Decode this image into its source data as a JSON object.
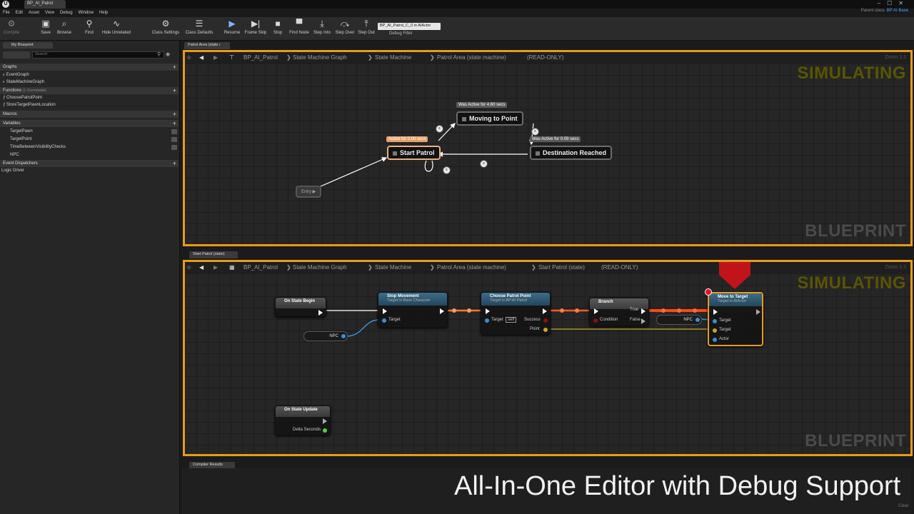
{
  "window": {
    "tab": "BP_AI_Patrol",
    "parent_class_label": "Parent class",
    "parent_class_value": "BP AI Base"
  },
  "menu": [
    "File",
    "Edit",
    "Asset",
    "View",
    "Debug",
    "Window",
    "Help"
  ],
  "toolbar": {
    "compile": "Compile",
    "save": "Save",
    "browse": "Browse",
    "find": "Find",
    "hide_unrelated": "Hide Unrelated",
    "class_settings": "Class Settings",
    "class_defaults": "Class Defaults",
    "resume": "Resume",
    "frame_skip": "Frame Skip",
    "stop": "Stop",
    "find_node": "Find Node",
    "step_into": "Step Into",
    "step_over": "Step Over",
    "step_out": "Step Out",
    "debug_object": "BP_AI_Patrol_C_0 in AIActor",
    "debug_filter": "Debug Filter"
  },
  "left_panel": {
    "tab": "My Blueprint",
    "search_placeholder": "Search",
    "graphs_header": "Graphs",
    "graphs": [
      "EventGraph",
      "StateMachineGraph"
    ],
    "functions_header": "Functions",
    "functions_note": "(1 Overridable)",
    "functions": [
      "ChoosePatrolPoint",
      "StoreTargetPawnLocation"
    ],
    "macros_header": "Macros",
    "variables_header": "Variables",
    "variables": [
      "TargetPawn",
      "TargetPoint",
      "TimeBetweenVisibilityChecks",
      "NPC"
    ],
    "dispatchers_header": "Event Dispatchers",
    "logic_driver": "Logic Driver"
  },
  "top_graph": {
    "tab": "Patrol Area (state ı",
    "crumbs": [
      "BP_AI_Patrol",
      "State Machine Graph",
      "State Machine",
      "Patrol Area (state machine)",
      "(READ-ONLY)"
    ],
    "zoom": "Zoom 1:1",
    "watermark_top": "SIMULATING",
    "watermark_bottom": "BLUEPRINT",
    "states": {
      "moving": {
        "label": "Moving to Point",
        "badge": "Was Active for 4.60 secs"
      },
      "start": {
        "label": "Start Patrol",
        "badge": "Active for 0.00 secs"
      },
      "dest": {
        "label": "Destination Reached",
        "badge": "Was Active for 0.09 secs"
      },
      "entry": "Entry"
    }
  },
  "bottom_graph": {
    "tab": "Start Patrol (state)",
    "crumbs": [
      "BP_AI_Patrol",
      "State Machine Graph",
      "State Machine",
      "Patrol Area (state machine)",
      "Start Patrol (state)",
      "(READ-ONLY)"
    ],
    "zoom": "Zoom 1:1",
    "watermark_top": "SIMULATING",
    "watermark_bottom": "BLUEPRINT",
    "on_state_begin": "On State Begin",
    "on_state_update": "On State Update",
    "delta_seconds": "Delta Seconds",
    "stop_movement": {
      "title": "Stop Movement",
      "sub": "Target is Base Character",
      "target": "Target"
    },
    "npc": "NPC",
    "choose": {
      "title": "Choose Patrol Point",
      "sub": "Target is BP AI Patrol",
      "target": "Target",
      "self": "self",
      "success": "Success",
      "point": "Point"
    },
    "branch": {
      "title": "Branch",
      "condition": "Condition",
      "true": "True",
      "false": "False"
    },
    "move": {
      "title": "Move to Target",
      "sub": "Target is AIActor",
      "target1": "Target",
      "target2": "Target",
      "actor": "Actor"
    }
  },
  "compiler": {
    "tab": "Compiler Results",
    "clear": "Clear"
  },
  "headline": "All-In-One Editor with Debug Support"
}
